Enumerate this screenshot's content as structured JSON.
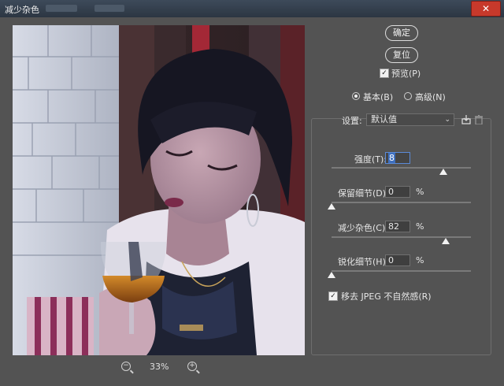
{
  "window": {
    "title": "减少杂色",
    "close_label": "✕"
  },
  "buttons": {
    "ok": "确定",
    "reset": "复位"
  },
  "preview_toggle": {
    "label": "预览(P)",
    "checked": true
  },
  "mode": {
    "options": [
      {
        "label": "基本(B)",
        "selected": true
      },
      {
        "label": "高级(N)",
        "selected": false
      }
    ]
  },
  "settings": {
    "label": "设置:",
    "value": "默认值"
  },
  "sliders": [
    {
      "label": "强度(T):",
      "value": "8",
      "fraction": 0.8,
      "unit": ""
    },
    {
      "label": "保留细节(D):",
      "value": "0",
      "fraction": 0.0,
      "unit": "%"
    },
    {
      "label": "减少杂色(C):",
      "value": "82",
      "fraction": 0.82,
      "unit": "%"
    },
    {
      "label": "锐化细节(H):",
      "value": "0",
      "fraction": 0.0,
      "unit": "%"
    }
  ],
  "jpeg_artifact": {
    "label": "移去 JPEG 不自然感(R)",
    "checked": true
  },
  "zoom": {
    "level": "33%"
  },
  "colors": {
    "panel": "#535353",
    "titlebar": "#2c3642",
    "close": "#c7392b",
    "focus": "#5b8ad6"
  }
}
